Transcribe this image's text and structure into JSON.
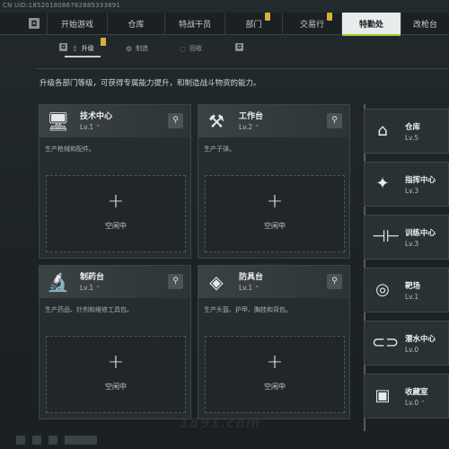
{
  "uid": "CN UID:1852018086762885333891",
  "tabs": [
    {
      "label": "开始游戏",
      "active": false,
      "badge": false
    },
    {
      "label": "仓库",
      "active": false,
      "badge": false
    },
    {
      "label": "特战干员",
      "active": false,
      "badge": false
    },
    {
      "label": "部门",
      "active": false,
      "badge": true
    },
    {
      "label": "交易行",
      "active": false,
      "badge": true
    },
    {
      "label": "特勤处",
      "active": true,
      "badge": false
    },
    {
      "label": "改枪台",
      "active": false,
      "badge": false
    }
  ],
  "subtabs": [
    {
      "label": "升级",
      "icon": "upgrade-icon",
      "active": true
    },
    {
      "label": "制造",
      "icon": "craft-icon",
      "active": false
    },
    {
      "label": "回收",
      "icon": "recycle-icon",
      "active": false
    }
  ],
  "description": "升级各部门等级，可获得专属能力提升，和制造战斗物资的能力。",
  "cards": [
    {
      "name": "技术中心",
      "level": "Lv.1",
      "text": "生产枪械和配件。",
      "icon": "computer-icon",
      "slot": "空闲中"
    },
    {
      "name": "工作台",
      "level": "Lv.2",
      "text": "生产子弹。",
      "icon": "tools-icon",
      "slot": "空闲中"
    },
    {
      "name": "制药台",
      "level": "Lv.1",
      "text": "生产药品、针剂和维修工具包。",
      "icon": "microscope-icon",
      "slot": "空闲中"
    },
    {
      "name": "防具台",
      "level": "Lv.1",
      "text": "生产头盔、护甲、胸挂和背包。",
      "icon": "armor-icon",
      "slot": "空闲中"
    }
  ],
  "side": [
    {
      "name": "仓库",
      "level": "Lv.5",
      "icon": "warehouse-icon"
    },
    {
      "name": "指挥中心",
      "level": "Lv.3",
      "icon": "command-icon"
    },
    {
      "name": "训练中心",
      "level": "Lv.3",
      "icon": "dumbbell-icon"
    },
    {
      "name": "靶场",
      "level": "Lv.1",
      "icon": "target-icon"
    },
    {
      "name": "潜水中心",
      "level": "Lv.0",
      "icon": "diving-mask-icon"
    },
    {
      "name": "收藏室",
      "level": "Lv.0",
      "icon": "collection-icon"
    }
  ],
  "watermark": "1891.com",
  "colors": {
    "accent": "#9fd232",
    "badge": "#d7b03a"
  }
}
